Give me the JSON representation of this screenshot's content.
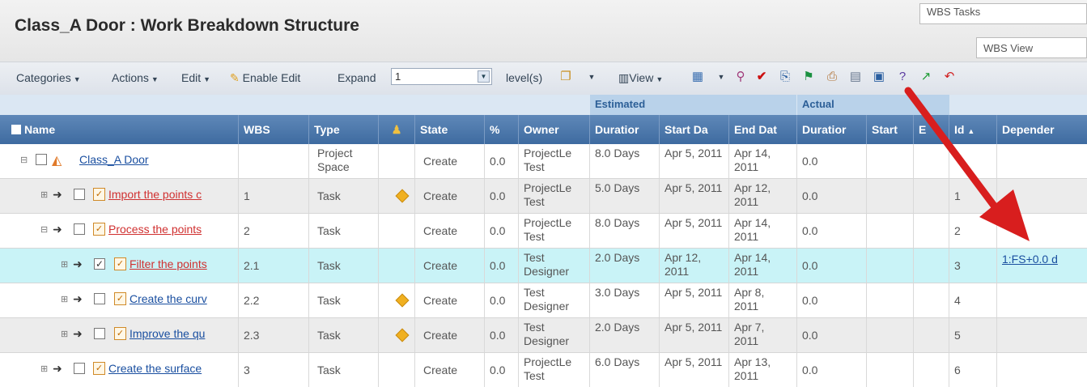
{
  "title": "Class_A Door : Work Breakdown Structure",
  "right_dropdowns": {
    "tasks": "WBS Tasks",
    "view": "WBS View"
  },
  "toolbar": {
    "categories": "Categories",
    "actions": "Actions",
    "edit": "Edit",
    "enable_edit": "Enable Edit",
    "expand_label": "Expand",
    "expand_value": "1",
    "levels": "level(s)",
    "view": "View"
  },
  "groups": {
    "estimated": "Estimated",
    "actual": "Actual"
  },
  "columns": {
    "name": "Name",
    "wbs": "WBS",
    "type": "Type",
    "state": "State",
    "pct": "%",
    "owner": "Owner",
    "est_duration": "Duratior",
    "est_start": "Start Da",
    "est_end": "End Dat",
    "act_duration": "Duratior",
    "act_start": "Start",
    "act_end": "E",
    "id": "Id",
    "id_sort": "▲",
    "dependency": "Depender"
  },
  "rows": [
    {
      "name": "Class_A Door",
      "wbs": "",
      "type": "Project Space",
      "state": "Create",
      "pct": "0.0",
      "owner": "ProjectLe Test",
      "duration": "8.0 Days",
      "start": "Apr 5, 2011",
      "end": "Apr 14, 2011",
      "act_duration": "0.0",
      "id": "",
      "dependency": ""
    },
    {
      "name": "Import the points c",
      "wbs": "1",
      "type": "Task",
      "state": "Create",
      "pct": "0.0",
      "owner": "ProjectLe Test",
      "duration": "5.0 Days",
      "start": "Apr 5, 2011",
      "end": "Apr 12, 2011",
      "act_duration": "0.0",
      "id": "1",
      "dependency": ""
    },
    {
      "name": "Process the points",
      "wbs": "2",
      "type": "Task",
      "state": "Create",
      "pct": "0.0",
      "owner": "ProjectLe Test",
      "duration": "8.0 Days",
      "start": "Apr 5, 2011",
      "end": "Apr 14, 2011",
      "act_duration": "0.0",
      "id": "2",
      "dependency": ""
    },
    {
      "name": "Filter the points",
      "wbs": "2.1",
      "type": "Task",
      "state": "Create",
      "pct": "0.0",
      "owner": "Test Designer",
      "duration": "2.0 Days",
      "start": "Apr 12, 2011",
      "end": "Apr 14, 2011",
      "act_duration": "0.0",
      "id": "3",
      "dependency": "1:FS+0.0 d"
    },
    {
      "name": "Create the curv",
      "wbs": "2.2",
      "type": "Task",
      "state": "Create",
      "pct": "0.0",
      "owner": "Test Designer",
      "duration": "3.0 Days",
      "start": "Apr 5, 2011",
      "end": "Apr 8, 2011",
      "act_duration": "0.0",
      "id": "4",
      "dependency": ""
    },
    {
      "name": "Improve the qu",
      "wbs": "2.3",
      "type": "Task",
      "state": "Create",
      "pct": "0.0",
      "owner": "Test Designer",
      "duration": "2.0 Days",
      "start": "Apr 5, 2011",
      "end": "Apr 7, 2011",
      "act_duration": "0.0",
      "id": "5",
      "dependency": ""
    },
    {
      "name": "Create the surface",
      "wbs": "3",
      "type": "Task",
      "state": "Create",
      "pct": "0.0",
      "owner": "ProjectLe Test",
      "duration": "6.0 Days",
      "start": "Apr 5, 2011",
      "end": "Apr 13, 2011",
      "act_duration": "0.0",
      "id": "6",
      "dependency": ""
    }
  ],
  "colors": {
    "header_blue": "#4a76aa",
    "selected_row": "#c9f3f7",
    "link_red": "#d03030",
    "link_blue": "#1a4fa0",
    "arrow_red": "#d81e1e"
  }
}
